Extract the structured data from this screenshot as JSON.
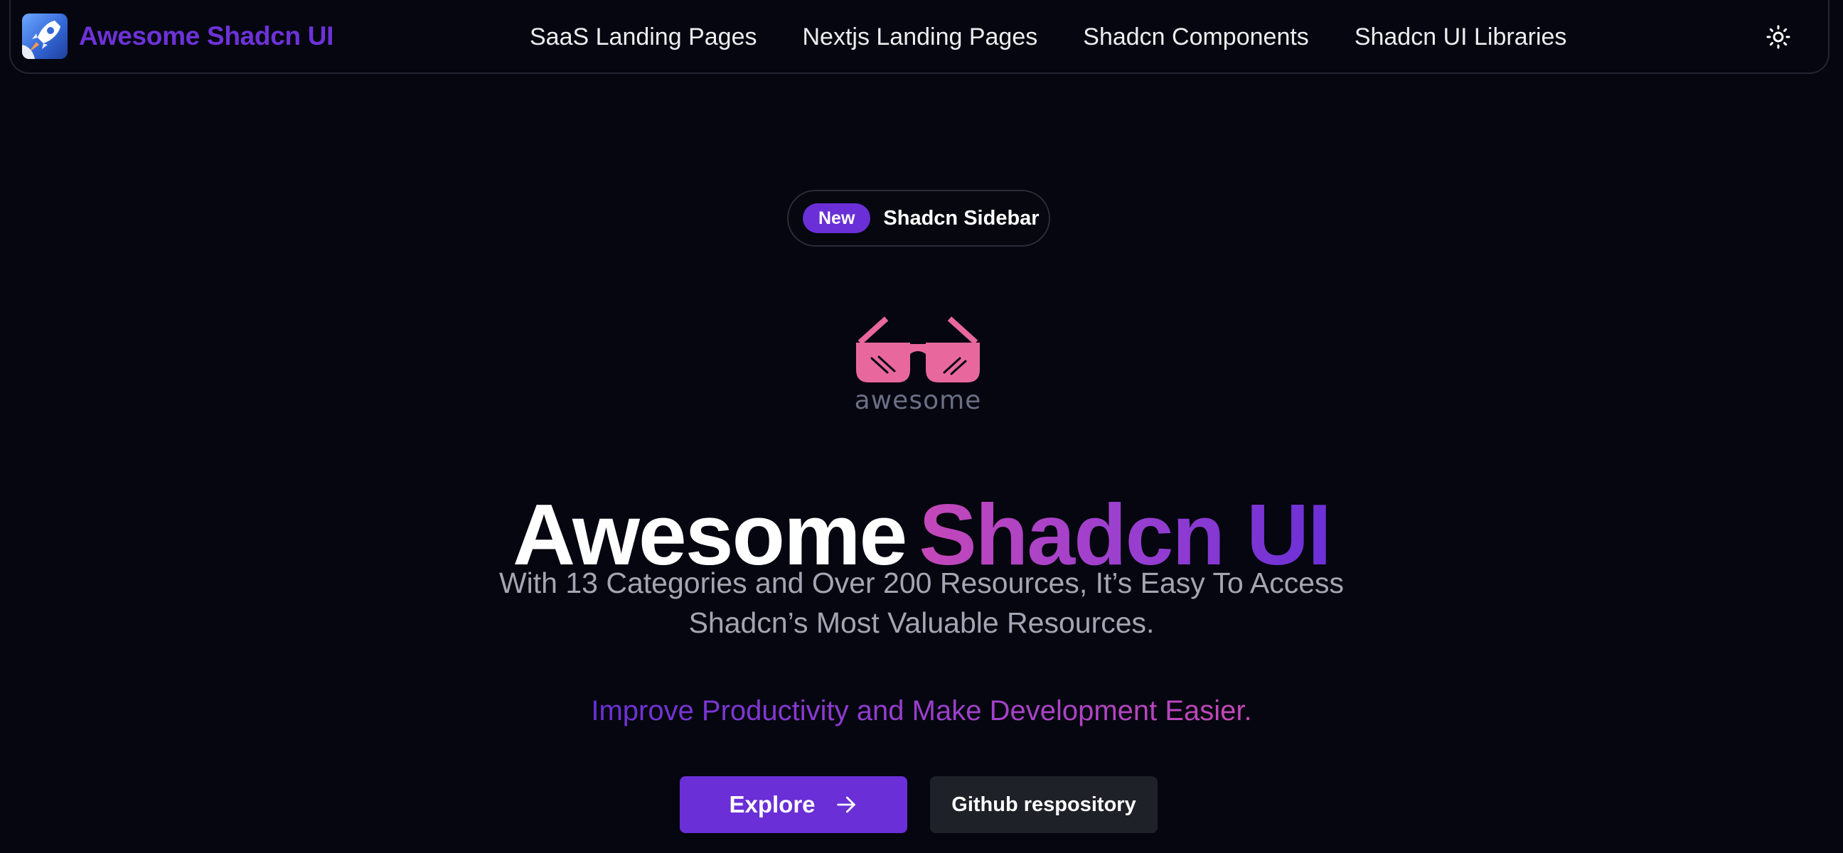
{
  "header": {
    "brand_name": "Awesome Shadcn UI",
    "nav": [
      {
        "label": "SaaS Landing Pages"
      },
      {
        "label": "Nextjs Landing Pages"
      },
      {
        "label": "Shadcn Components"
      },
      {
        "label": "Shadcn UI Libraries"
      }
    ],
    "theme_icon": "sun-icon"
  },
  "announcement": {
    "badge": "New",
    "text": "Shadcn Sidebar"
  },
  "hero": {
    "logo_text": "awesome",
    "title_part1": "Awesome",
    "title_part2": "Shadcn UI",
    "subtitle_line1": "With 13 Categories and Over 200 Resources, It’s Easy To Access",
    "subtitle_line2": "Shadcn’s Most Valuable Resources.",
    "tagline": "Improve Productivity and Make Development Easier.",
    "primary_button": "Explore",
    "secondary_button": "Github respository"
  },
  "colors": {
    "background": "#05060f",
    "accent": "#6a2fd6",
    "accent_pink": "#c548b8",
    "logo_pink": "#e8689e"
  }
}
